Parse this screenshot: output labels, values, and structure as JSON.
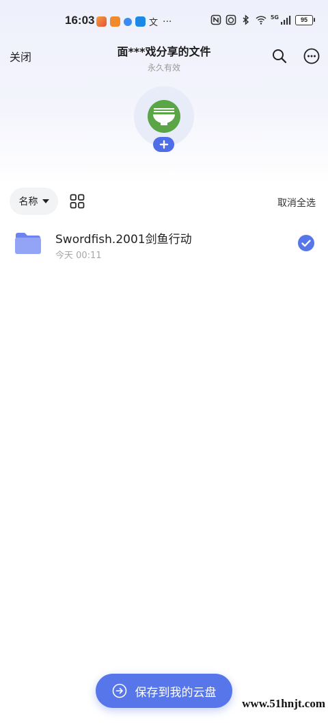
{
  "status_bar": {
    "time": "16:03",
    "overflow": "···",
    "battery": "95",
    "network": "5G",
    "icons": [
      "nfc-icon",
      "alarm-icon",
      "bluetooth-icon",
      "wifi-icon",
      "signal-icon",
      "battery-icon"
    ]
  },
  "header": {
    "close_label": "关闭",
    "title": "面***戏分享的文件",
    "subtitle": "永久有效"
  },
  "toolbar": {
    "sort_label": "名称",
    "deselect_all": "取消全选"
  },
  "files": [
    {
      "name": "Swordfish.2001剑鱼行动",
      "time": "今天 00:11",
      "selected": true
    }
  ],
  "save_button": {
    "label": "保存到我的云盘"
  },
  "watermark": "www.51hnjt.com",
  "colors": {
    "accent": "#5676ea",
    "folder": "#8b9bf2",
    "avatar_green": "#5aa646"
  }
}
